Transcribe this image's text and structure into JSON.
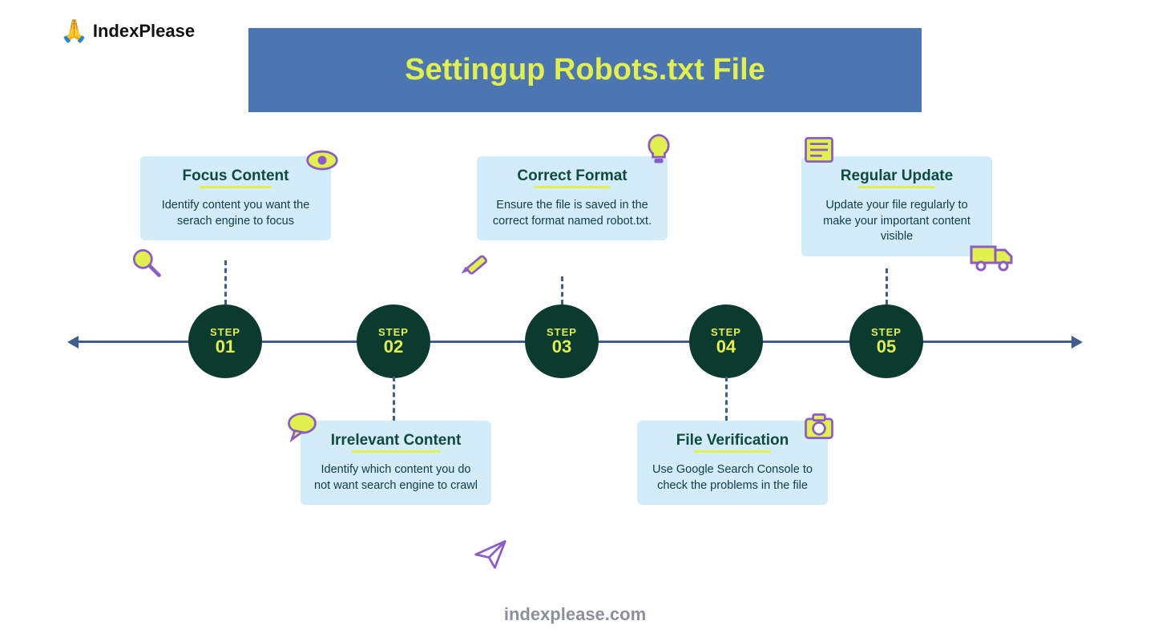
{
  "brand": {
    "emoji": "🙏",
    "name": "IndexPlease"
  },
  "title": "Settingup Robots.txt File",
  "footer": "indexplease.com",
  "timeline": {
    "step_label": "STEP",
    "steps": [
      {
        "num": "01",
        "title": "Focus Content",
        "desc": "Identify content you want the serach engine to focus",
        "icon": "eye"
      },
      {
        "num": "02",
        "title": "Irrelevant Content",
        "desc": "Identify which content you do not want search engine to crawl",
        "icon": "speech"
      },
      {
        "num": "03",
        "title": "Correct Format",
        "desc": "Ensure the file is saved in the correct format named robot.txt.",
        "icon": "bulb"
      },
      {
        "num": "04",
        "title": "File Verification",
        "desc": "Use Google Search Console to check the problems in the file",
        "icon": "camera"
      },
      {
        "num": "05",
        "title": "Regular Update",
        "desc": "Update your file regularly to make your important content visible",
        "icon": "news"
      }
    ],
    "extra_icons": [
      "magnifier",
      "pencil",
      "paperplane",
      "truck"
    ]
  }
}
